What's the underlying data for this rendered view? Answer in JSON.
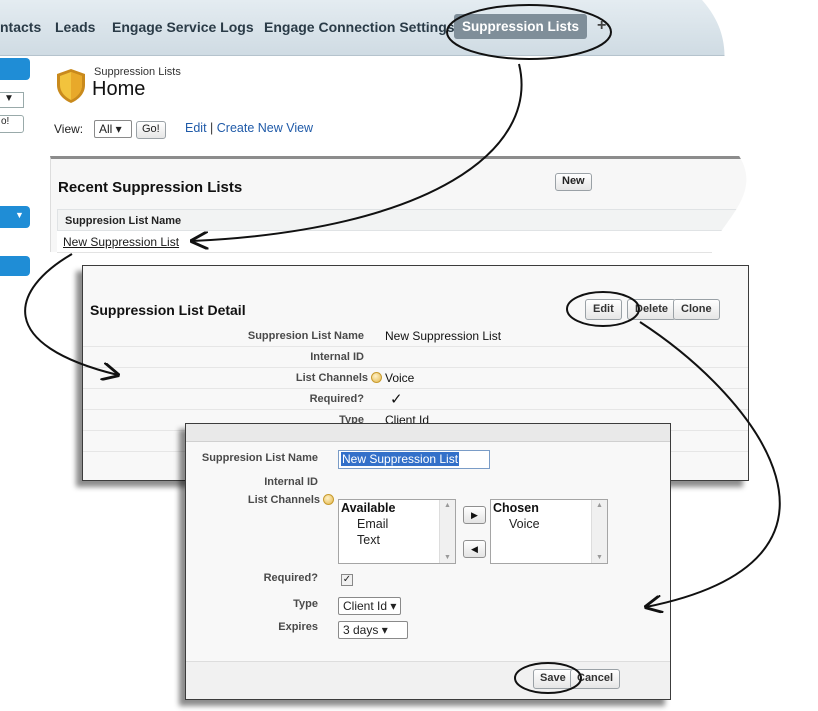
{
  "nav": {
    "tabs": [
      "ntacts",
      "Leads",
      "Engage Service Logs",
      "Engage Connection Settings",
      "Suppression Lists"
    ],
    "plus": "+"
  },
  "sidebar": {
    "select_fragment": "▼",
    "button_fragment": "o!"
  },
  "home": {
    "header_small": "Suppression Lists",
    "header_big": "Home",
    "view_label": "View:",
    "view_value": "All ▾",
    "go_label": "Go!",
    "edit_link": "Edit",
    "separator": " | ",
    "create_link": "Create New View",
    "recent_title": "Recent Suppression Lists",
    "new_button": "New",
    "column_header": "Suppresion List Name",
    "row_link": "New Suppression List"
  },
  "detail": {
    "title": "Suppression List Detail",
    "edit_button": "Edit",
    "delete_button": "Delete",
    "clone_button": "Clone",
    "rows": [
      {
        "label": "Suppresion List Name",
        "value": "New Suppression List"
      },
      {
        "label": "Internal ID",
        "value": ""
      },
      {
        "label": "List Channels",
        "value": "Voice"
      },
      {
        "label": "Required?",
        "value": "✓"
      },
      {
        "label": "Type",
        "value": "Client Id"
      }
    ]
  },
  "edit": {
    "name_label": "Suppresion List Name",
    "name_value": "New Suppression List",
    "internal_id_label": "Internal ID",
    "channels_label": "List Channels",
    "available_heading": "Available",
    "available_items": [
      "Email",
      "Text"
    ],
    "chosen_heading": "Chosen",
    "chosen_items": [
      "Voice"
    ],
    "add_arrow": "▶",
    "remove_arrow": "◀",
    "required_label": "Required?",
    "required_checked": "✓",
    "type_label": "Type",
    "type_value": "Client Id ▾",
    "expires_label": "Expires",
    "expires_value": "3 days   ▾",
    "save_button": "Save",
    "cancel_button": "Cancel"
  },
  "colors": {
    "active_tab": "#7f8e99",
    "link": "#1f5aa8",
    "sidebar_accent": "#1f8dd6",
    "selection": "#3370c9"
  }
}
